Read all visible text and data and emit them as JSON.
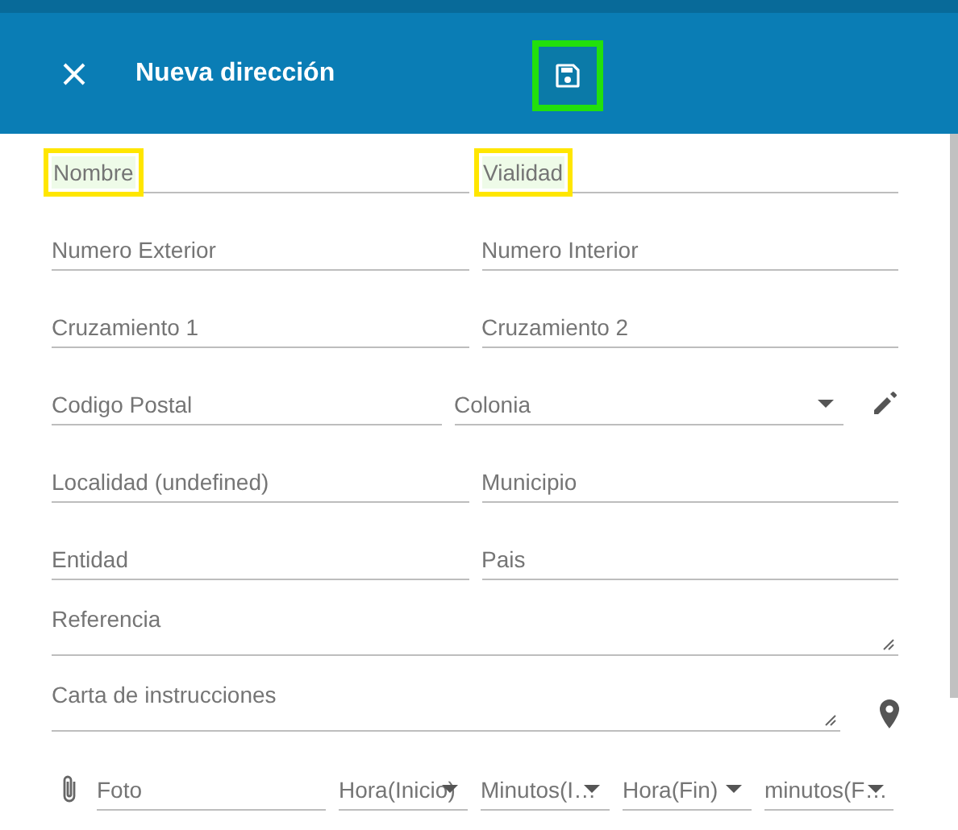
{
  "header": {
    "title": "Nueva dirección",
    "save_highlighted": true
  },
  "rows": [
    {
      "kind": "pair",
      "fields": [
        {
          "placeholder": "Nombre",
          "kind": "text",
          "highlighted": true
        },
        {
          "placeholder": "Vialidad",
          "kind": "text",
          "highlighted": true
        }
      ]
    },
    {
      "kind": "pair",
      "fields": [
        {
          "placeholder": "Numero Exterior",
          "kind": "text",
          "highlighted": false
        },
        {
          "placeholder": "Numero Interior",
          "kind": "text",
          "highlighted": false
        }
      ]
    },
    {
      "kind": "pair",
      "fields": [
        {
          "placeholder": "Cruzamiento 1",
          "kind": "text",
          "highlighted": false
        },
        {
          "placeholder": "Cruzamiento 2",
          "kind": "text",
          "highlighted": false
        }
      ]
    },
    {
      "kind": "edit",
      "fields": [
        {
          "placeholder": "Codigo Postal",
          "kind": "text",
          "highlighted": false
        },
        {
          "placeholder": "Colonia",
          "kind": "select",
          "highlighted": false
        }
      ]
    },
    {
      "kind": "pair",
      "fields": [
        {
          "placeholder": "Localidad (undefined)",
          "kind": "text",
          "highlighted": false
        },
        {
          "placeholder": "Municipio",
          "kind": "text",
          "highlighted": false
        }
      ]
    },
    {
      "kind": "pair",
      "fields": [
        {
          "placeholder": "Entidad",
          "kind": "text",
          "highlighted": false
        },
        {
          "placeholder": "Pais",
          "kind": "text",
          "highlighted": false
        }
      ]
    },
    {
      "kind": "area",
      "fields": [
        {
          "placeholder": "Referencia",
          "kind": "textarea",
          "highlighted": false
        }
      ]
    },
    {
      "kind": "location",
      "fields": [
        {
          "placeholder": "Carta de instrucciones",
          "kind": "textarea",
          "highlighted": false
        }
      ]
    },
    {
      "kind": "attach",
      "fields": [
        {
          "placeholder": "Foto",
          "kind": "text",
          "highlighted": false
        },
        {
          "placeholder": "Hora(Inicio)",
          "kind": "select",
          "highlighted": false
        },
        {
          "placeholder": "Minutos(I…",
          "kind": "select",
          "highlighted": false
        },
        {
          "placeholder": "Hora(Fin)",
          "kind": "select",
          "highlighted": false
        },
        {
          "placeholder": "minutos(F…",
          "kind": "select",
          "highlighted": false
        }
      ]
    }
  ]
}
